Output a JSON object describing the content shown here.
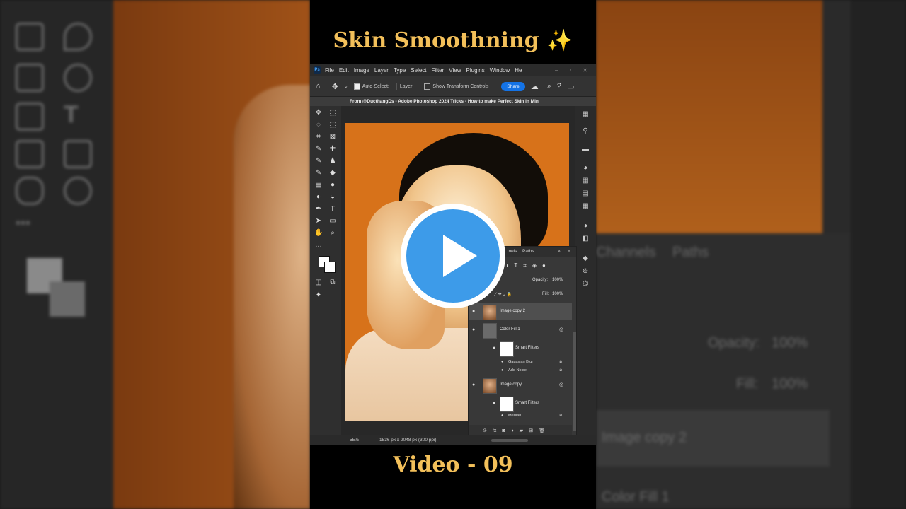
{
  "headline": "Skin Smoothning ✨",
  "footer_title": "Video - 09",
  "photoshop": {
    "menu": [
      "File",
      "Edit",
      "Image",
      "Layer",
      "Type",
      "Select",
      "Filter",
      "View",
      "Plugins",
      "Window",
      "He"
    ],
    "options": {
      "auto_select_label": "Auto-Select:",
      "auto_select_value": "Layer",
      "transform_label": "Show Transform Controls",
      "share_label": "Share"
    },
    "document_tab": "From @DucthangDs - Adobe Photoshop 2024 Tricks - How to make Perfect Skin in Min",
    "status": {
      "zoom": "55%",
      "doc_info": "1536 px x 2048 px (300 ppi)"
    },
    "layers_panel": {
      "tabs": [
        "…nels",
        "Paths"
      ],
      "opacity_label": "Opacity:",
      "opacity_value": "100%",
      "fill_label": "Fill:",
      "fill_value": "100%",
      "layers": [
        {
          "name": "Image copy 2",
          "selected": true
        },
        {
          "name": "Color Fill 1"
        },
        {
          "name": "Smart Filters"
        },
        {
          "name": "Gaussian Blur"
        },
        {
          "name": "Add Noise"
        },
        {
          "name": "Image copy"
        },
        {
          "name": "Smart Filters"
        },
        {
          "name": "Median"
        }
      ]
    }
  },
  "background": {
    "left_tab": "Channels",
    "right_tab_paths": "Paths",
    "opacity_label": "Opacity:",
    "opacity_value": "100%",
    "fill_label": "Fill:",
    "fill_value": "100%",
    "layer1": "Image copy 2",
    "layer2": "Color Fill 1"
  },
  "icons": {
    "play": "play-icon",
    "home": "home-icon",
    "move": "move-icon",
    "search": "search-icon",
    "help": "help-icon",
    "eye": "eye-icon"
  },
  "colors": {
    "headline": "#f3c05a",
    "play_blue": "#3d9be9",
    "ps_share": "#1473e6",
    "photo_bg": "#d7721a"
  }
}
